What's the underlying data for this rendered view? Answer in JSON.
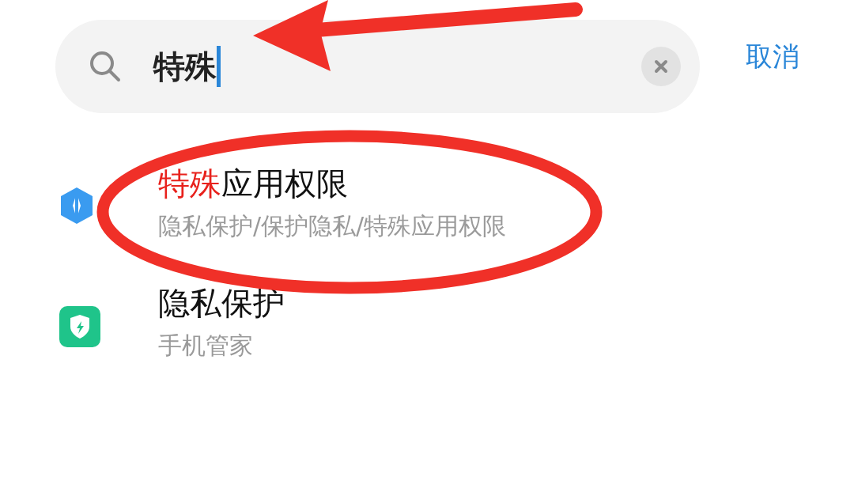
{
  "search": {
    "value": "特殊",
    "cancel": "取消"
  },
  "results": [
    {
      "kind": "permissions",
      "match": "特殊",
      "title": "应用权限",
      "subtitle": "隐私保护/保护隐私/特殊应用权限"
    },
    {
      "kind": "security",
      "title": "隐私保护",
      "subtitle": "手机管家"
    }
  ]
}
